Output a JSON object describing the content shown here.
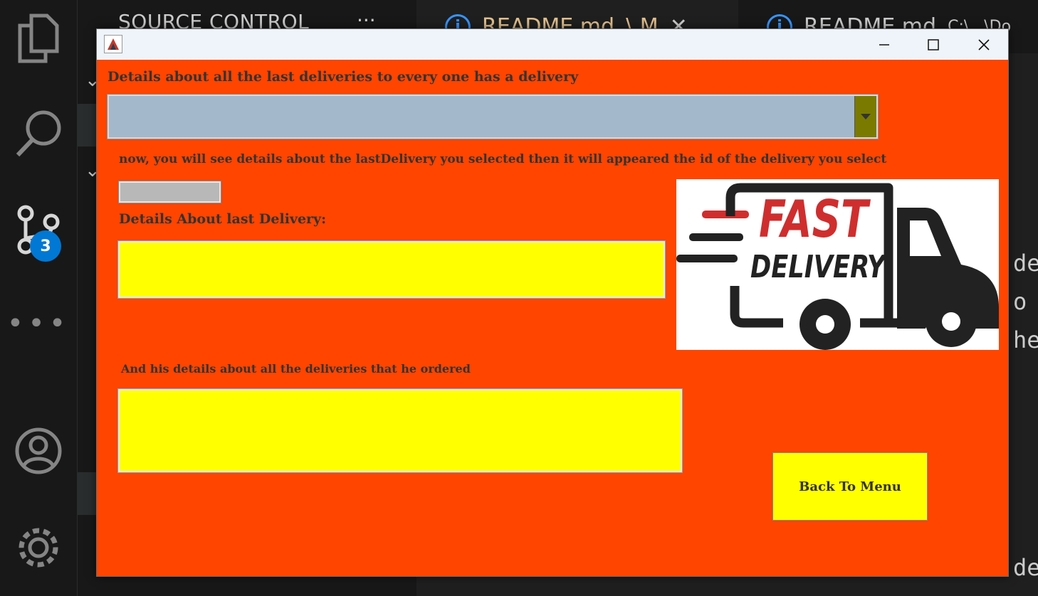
{
  "vscode": {
    "sidebar_title": "SOURCE CONTROL",
    "sidebar_more": "···",
    "scm_badge": "3",
    "tabs": [
      {
        "label": "README.md",
        "suffix": "\\ M"
      },
      {
        "label": "README.md",
        "suffix": "C:\\...\\Do"
      }
    ],
    "editor_fragments": [
      "de",
      "o r",
      "he",
      "del"
    ]
  },
  "window": {
    "title": "",
    "heading": "Details about all the last deliveries to every one has a delivery",
    "combo_value": "",
    "instruction": "now, you will see details about the lastDelivery you selected then it will appeared the id of the delivery you select",
    "id_value": "",
    "last_delivery_label": "Details About last Delivery:",
    "last_delivery_text": "",
    "all_deliveries_label": "And his details about all the deliveries that he ordered",
    "all_deliveries_text": "",
    "back_button": "Back To Menu",
    "logo_line1": "FAST",
    "logo_line2": "DELIVERY"
  },
  "colors": {
    "window_bg": "#ff4500",
    "text_area_bg": "#ffff00",
    "combo_bg": "#a4b8cc",
    "logo_red": "#cf2e2e",
    "logo_dark": "#222222"
  }
}
